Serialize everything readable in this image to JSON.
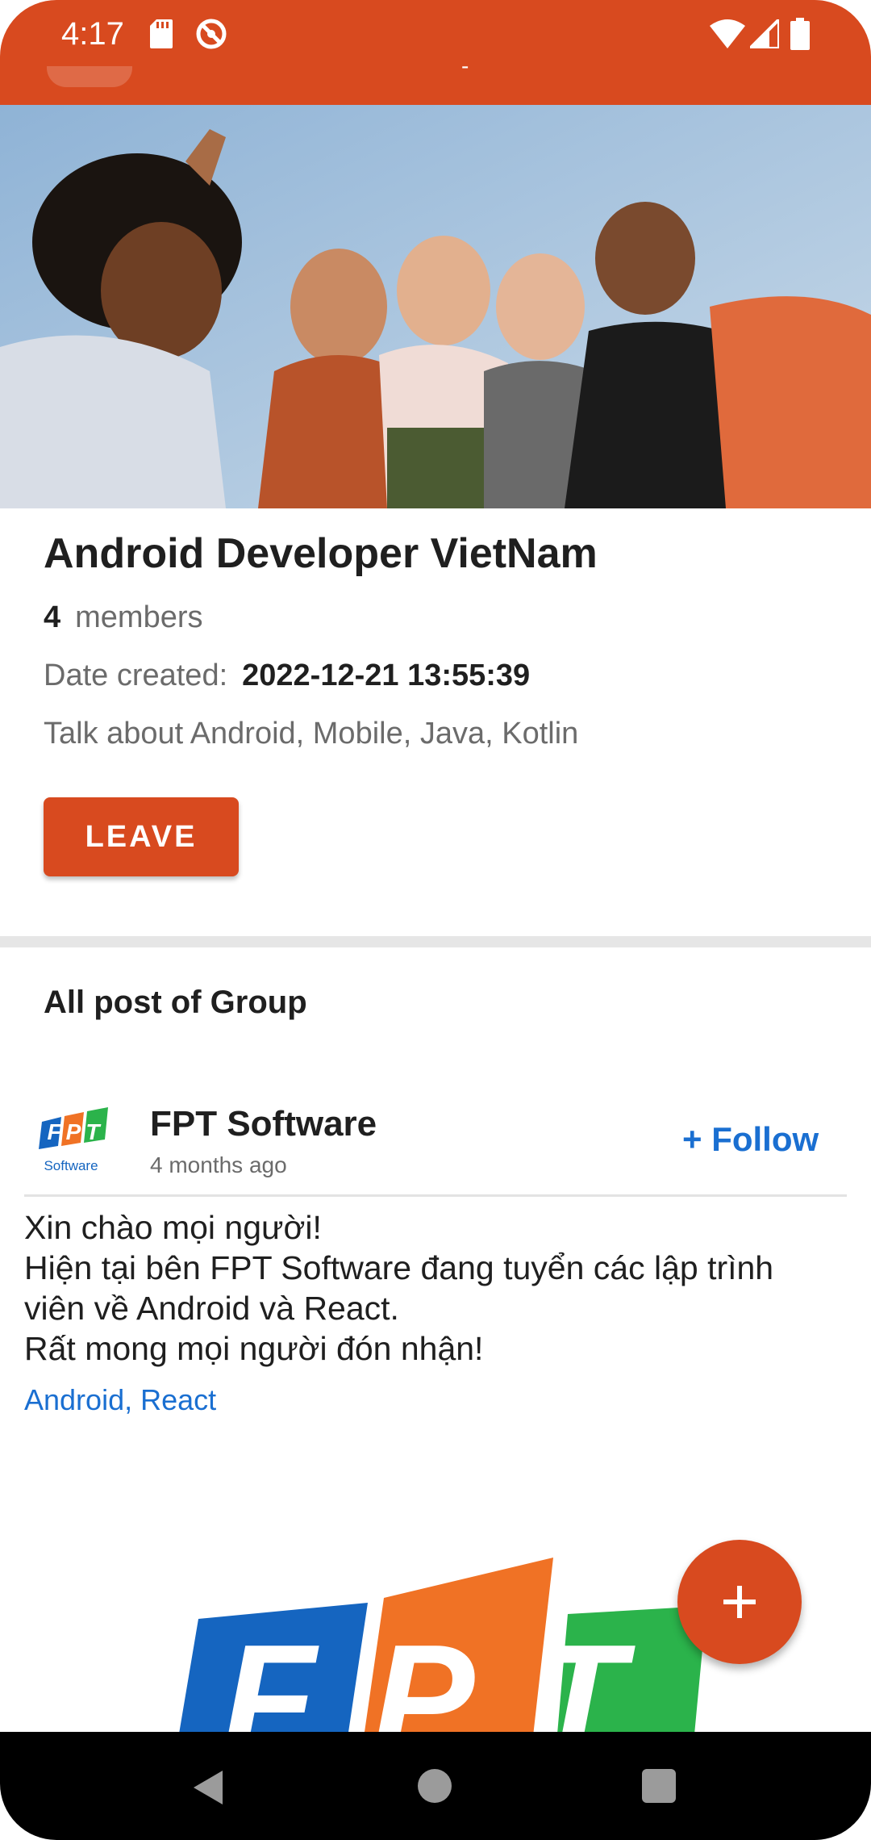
{
  "status_bar": {
    "time": "4:17",
    "icons": [
      "sd-card-icon",
      "location-off-icon",
      "wifi-icon",
      "signal-icon",
      "battery-icon"
    ],
    "color": "#D84A1F"
  },
  "toolbar": {
    "title": "-"
  },
  "group": {
    "name": "Android Developer VietNam",
    "members_count": "4",
    "members_label": "members",
    "date_label": "Date created:",
    "date_value": "2022-12-21 13:55:39",
    "description": "Talk about Android, Mobile, Java, Kotlin",
    "leave_label": "LEAVE"
  },
  "posts_section": {
    "heading": "All post of Group"
  },
  "post": {
    "avatar_logo_text": "FPT",
    "avatar_logo_subtext": "Software",
    "author": "FPT Software",
    "time": "4 months ago",
    "follow_label": "+ Follow",
    "body_lines": [
      "Xin chào mọi người!",
      "Hiện tại bên FPT Software đang tuyển các lập trình viên về Android và React.",
      "Rất mong mọi người đón nhận!"
    ],
    "tags": "Android, React",
    "image_logo_text": "FPT"
  },
  "fab": {
    "icon": "plus-icon"
  },
  "nav_bar": {
    "icons": [
      "back-triangle-icon",
      "home-circle-icon",
      "recents-square-icon"
    ]
  },
  "colors": {
    "accent": "#D84A1F",
    "link": "#1a6fd1",
    "fpt_blue": "#1565C0",
    "fpt_orange": "#F07225",
    "fpt_green": "#2BB34B"
  }
}
